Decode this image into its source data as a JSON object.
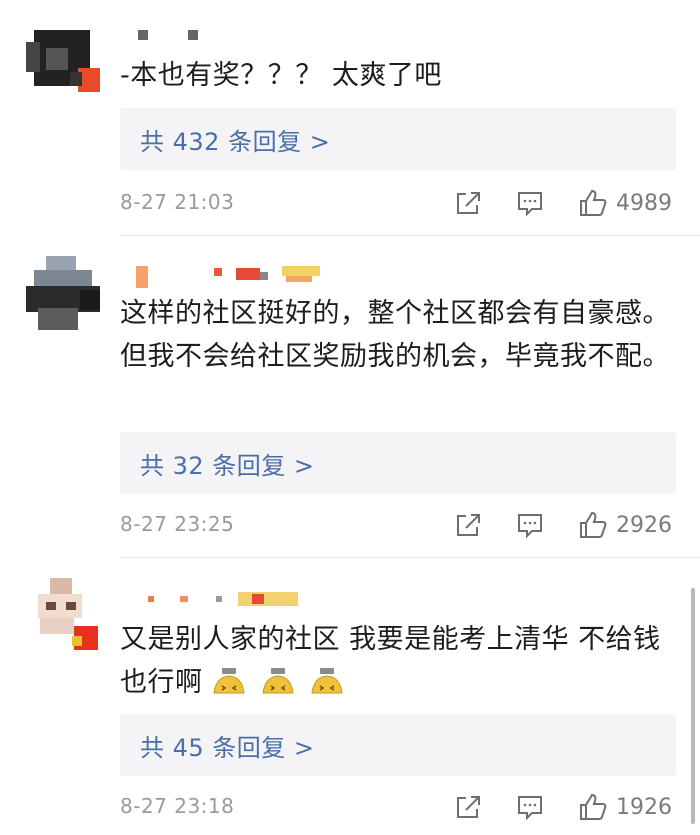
{
  "comments": [
    {
      "text": "-本也有奖？？？ 太爽了吧",
      "reply_label": "共 432 条回复 >",
      "time": "8-27 21:03",
      "likes": "4989",
      "emoji_count": 0
    },
    {
      "text": "这样的社区挺好的，整个社区都会有自豪感。但我不会给社区奖励我的机会，毕竟我不配。",
      "reply_label": "共 32 条回复 >",
      "time": "8-27 23:25",
      "likes": "2926",
      "emoji_count": 0
    },
    {
      "text": "又是别人家的社区 我要是能考上清华  不给钱也行啊",
      "reply_label": "共 45 条回复 >",
      "time": "8-27 23:18",
      "likes": "1926",
      "emoji_count": 3
    }
  ],
  "icons": {
    "share": "share-icon",
    "comment": "comment-icon",
    "like": "thumbs-up-icon",
    "emoji": "doge-emoji-icon"
  },
  "colors": {
    "reply_link": "#4a6ea8",
    "reply_bg": "#f4f4f6",
    "meta_text": "#9a9a9a"
  }
}
